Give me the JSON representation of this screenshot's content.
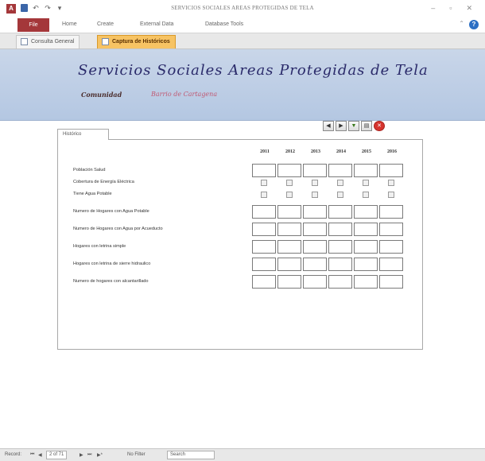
{
  "window": {
    "title": "SERVICIOS SOCIALES AREAS PROTEGIDAS DE TELA",
    "app_icon": "A",
    "qat_undo": "↶",
    "qat_redo": "↷",
    "qat_more": "▾",
    "minimize": "–",
    "maximize": "▫",
    "close": "✕"
  },
  "ribbon": {
    "file": "File",
    "tabs": [
      "Home",
      "Create",
      "External Data",
      "Database Tools"
    ],
    "help": "?",
    "minimize_ribbon": "⌃"
  },
  "doc_tabs": [
    {
      "label": "Consulta General",
      "active": false
    },
    {
      "label": "Captura de Históricos",
      "active": true
    }
  ],
  "header": {
    "title": "Servicios Sociales Areas Protegidas de Tela",
    "comunidad_label": "Comunidad",
    "comunidad_value": "Barrio de Cartagena"
  },
  "historico": {
    "tab_label": "Histórico",
    "nav": {
      "prev": "◀",
      "next": "▶",
      "filter": "▼",
      "report": "▤",
      "close": "✕"
    },
    "years": [
      "2011",
      "2012",
      "2013",
      "2014",
      "2015",
      "2016"
    ],
    "rows": [
      {
        "label": "Población Salud",
        "kind": "text"
      },
      {
        "label": "Cobertura de Energía Eléctrica",
        "kind": "check"
      },
      {
        "label": "Tiene Agua Potable",
        "kind": "check"
      },
      {
        "label": "Numero de Hogares con Agua Potable",
        "kind": "text"
      },
      {
        "label": "Numero de Hogares con Agua por Acueducto",
        "kind": "text"
      },
      {
        "label": "Hogares con letrina simple",
        "kind": "text"
      },
      {
        "label": "Hogares con letrina de sierre hidraulico",
        "kind": "text"
      },
      {
        "label": "Numero de hogares con alcantarillado",
        "kind": "text"
      }
    ]
  },
  "statusbar": {
    "record_label": "Record:",
    "first": "⏮",
    "prev": "◀",
    "position": "2 of 71",
    "next": "▶",
    "last": "⏭",
    "new": "▶*",
    "filter_status": "No Filter",
    "search": "Search"
  }
}
